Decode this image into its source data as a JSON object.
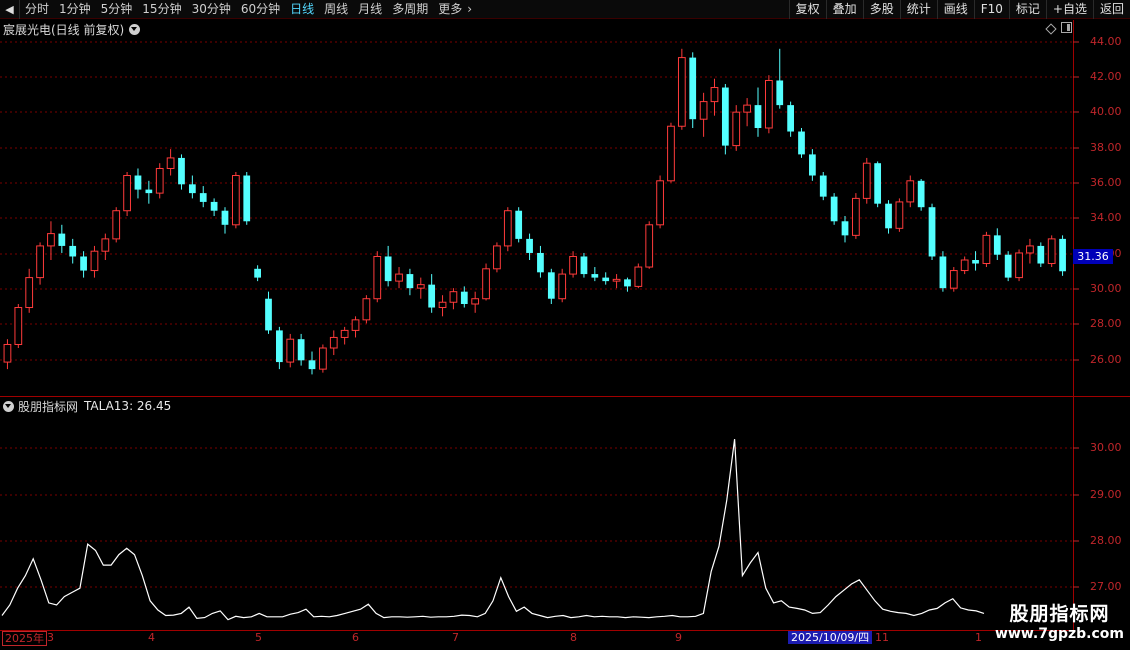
{
  "toolbar": {
    "back_icon": "back-arrow-icon",
    "periods": [
      "分时",
      "1分钟",
      "5分钟",
      "15分钟",
      "30分钟",
      "60分钟",
      "日线",
      "周线",
      "月线",
      "多周期",
      "更多"
    ],
    "active_period": "日线",
    "more_chevron": "›",
    "actions": [
      "复权",
      "叠加",
      "多股",
      "统计",
      "画线",
      "F10",
      "标记",
      "+自选",
      "返回"
    ]
  },
  "price_panel": {
    "title": "宸展光电(日线 前复权)",
    "axis_ticks": [
      "44.00",
      "42.00",
      "40.00",
      "38.00",
      "36.00",
      "34.00",
      "32.00",
      "30.00",
      "28.00",
      "26.00"
    ],
    "current_price": "31.36"
  },
  "indicator_panel": {
    "name": "股朋指标网",
    "indicator_label": "TALA13: 26.45",
    "axis_ticks": [
      "30.00",
      "29.00",
      "28.00",
      "27.00"
    ]
  },
  "date_axis": [
    "2025年",
    "3",
    "4",
    "5",
    "6",
    "7",
    "8",
    "9",
    "2025/10/09/四",
    "11",
    "1"
  ],
  "watermark": {
    "title": "股朋指标网",
    "url": "www.7gpzb.com"
  },
  "colors": {
    "up": "#ff3b3b",
    "down": "#54ffff",
    "grid": "#7a0000",
    "axis": "#c0262a",
    "indicator_line": "#ffffff",
    "highlight": "#1c1cb0"
  },
  "chart_data": [
    {
      "type": "candlestick",
      "title": "宸展光电(日线 前复权)",
      "ylim": [
        24.5,
        44.5
      ],
      "ohlc": [
        [
          26.2,
          27.5,
          25.8,
          27.2
        ],
        [
          27.2,
          29.5,
          27.0,
          29.3
        ],
        [
          29.3,
          31.5,
          29.0,
          31.0
        ],
        [
          31.0,
          33.0,
          30.6,
          32.8
        ],
        [
          32.8,
          34.2,
          32.0,
          33.5
        ],
        [
          33.5,
          34.0,
          32.4,
          32.8
        ],
        [
          32.8,
          33.2,
          31.8,
          32.2
        ],
        [
          32.2,
          32.5,
          31.0,
          31.4
        ],
        [
          31.4,
          32.8,
          31.0,
          32.5
        ],
        [
          32.5,
          33.5,
          32.0,
          33.2
        ],
        [
          33.2,
          35.0,
          33.0,
          34.8
        ],
        [
          34.8,
          37.0,
          34.5,
          36.8
        ],
        [
          36.8,
          37.2,
          35.5,
          36.0
        ],
        [
          36.0,
          36.5,
          35.2,
          35.8
        ],
        [
          35.8,
          37.5,
          35.5,
          37.2
        ],
        [
          37.2,
          38.3,
          36.8,
          37.8
        ],
        [
          37.8,
          38.0,
          36.0,
          36.3
        ],
        [
          36.3,
          36.8,
          35.5,
          35.8
        ],
        [
          35.8,
          36.2,
          35.0,
          35.3
        ],
        [
          35.3,
          35.5,
          34.5,
          34.8
        ],
        [
          34.8,
          35.0,
          33.5,
          34.0
        ],
        [
          34.0,
          37.0,
          33.8,
          36.8
        ],
        [
          36.8,
          37.0,
          34.0,
          34.2
        ],
        [
          31.5,
          31.7,
          30.8,
          31.0
        ],
        [
          29.8,
          30.2,
          27.8,
          28.0
        ],
        [
          28.0,
          28.2,
          25.8,
          26.2
        ],
        [
          26.2,
          27.8,
          25.9,
          27.5
        ],
        [
          27.5,
          27.8,
          26.0,
          26.3
        ],
        [
          26.3,
          26.8,
          25.5,
          25.8
        ],
        [
          25.8,
          27.2,
          25.6,
          27.0
        ],
        [
          27.0,
          28.0,
          26.6,
          27.6
        ],
        [
          27.6,
          28.2,
          27.2,
          28.0
        ],
        [
          28.0,
          28.8,
          27.6,
          28.6
        ],
        [
          28.6,
          30.0,
          28.4,
          29.8
        ],
        [
          29.8,
          32.5,
          29.6,
          32.2
        ],
        [
          32.2,
          32.8,
          30.5,
          30.8
        ],
        [
          30.8,
          31.6,
          30.4,
          31.2
        ],
        [
          31.2,
          31.5,
          30.0,
          30.4
        ],
        [
          30.4,
          31.0,
          29.8,
          30.6
        ],
        [
          30.6,
          31.2,
          29.0,
          29.3
        ],
        [
          29.3,
          30.0,
          28.8,
          29.6
        ],
        [
          29.6,
          30.4,
          29.2,
          30.2
        ],
        [
          30.2,
          30.5,
          29.3,
          29.5
        ],
        [
          29.5,
          30.2,
          29.0,
          29.8
        ],
        [
          29.8,
          31.8,
          29.7,
          31.5
        ],
        [
          31.5,
          33.0,
          31.3,
          32.8
        ],
        [
          32.8,
          35.0,
          32.5,
          34.8
        ],
        [
          34.8,
          35.0,
          33.0,
          33.2
        ],
        [
          33.2,
          33.5,
          32.0,
          32.4
        ],
        [
          32.4,
          32.8,
          31.0,
          31.3
        ],
        [
          31.3,
          31.5,
          29.5,
          29.8
        ],
        [
          29.8,
          31.5,
          29.6,
          31.2
        ],
        [
          31.2,
          32.5,
          31.0,
          32.2
        ],
        [
          32.2,
          32.4,
          31.0,
          31.2
        ],
        [
          31.2,
          31.6,
          30.8,
          31.0
        ],
        [
          31.0,
          31.3,
          30.6,
          30.8
        ],
        [
          30.8,
          31.2,
          30.4,
          30.9
        ],
        [
          30.9,
          31.0,
          30.2,
          30.5
        ],
        [
          30.5,
          31.8,
          30.4,
          31.6
        ],
        [
          31.6,
          34.2,
          31.5,
          34.0
        ],
        [
          34.0,
          36.8,
          33.8,
          36.5
        ],
        [
          36.5,
          39.8,
          36.4,
          39.6
        ],
        [
          39.6,
          44.0,
          39.4,
          43.5
        ],
        [
          43.5,
          43.8,
          39.5,
          40.0
        ],
        [
          40.0,
          41.5,
          39.0,
          41.0
        ],
        [
          41.0,
          42.3,
          40.2,
          41.8
        ],
        [
          41.8,
          42.0,
          38.0,
          38.5
        ],
        [
          38.5,
          40.8,
          38.2,
          40.4
        ],
        [
          40.4,
          41.2,
          39.6,
          40.8
        ],
        [
          40.8,
          41.8,
          39.0,
          39.5
        ],
        [
          39.5,
          42.5,
          39.2,
          42.2
        ],
        [
          42.2,
          44.0,
          40.6,
          40.8
        ],
        [
          40.8,
          41.0,
          39.0,
          39.3
        ],
        [
          39.3,
          39.5,
          37.8,
          38.0
        ],
        [
          38.0,
          38.3,
          36.5,
          36.8
        ],
        [
          36.8,
          37.0,
          35.4,
          35.6
        ],
        [
          35.6,
          35.8,
          34.0,
          34.2
        ],
        [
          34.2,
          34.5,
          33.0,
          33.4
        ],
        [
          33.4,
          35.8,
          33.2,
          35.5
        ],
        [
          35.5,
          37.8,
          35.2,
          37.5
        ],
        [
          37.5,
          37.6,
          35.0,
          35.2
        ],
        [
          35.2,
          35.4,
          33.5,
          33.8
        ],
        [
          33.8,
          35.5,
          33.6,
          35.3
        ],
        [
          35.3,
          36.8,
          35.0,
          36.5
        ],
        [
          36.5,
          36.6,
          34.8,
          35.0
        ],
        [
          35.0,
          35.2,
          32.0,
          32.2
        ],
        [
          32.2,
          32.5,
          30.2,
          30.4
        ],
        [
          30.4,
          31.6,
          30.2,
          31.4
        ],
        [
          31.4,
          32.2,
          31.2,
          32.0
        ],
        [
          32.0,
          32.5,
          31.4,
          31.8
        ],
        [
          31.8,
          33.6,
          31.6,
          33.4
        ],
        [
          33.4,
          33.8,
          32.0,
          32.3
        ],
        [
          32.3,
          32.5,
          30.8,
          31.0
        ],
        [
          31.0,
          32.6,
          30.8,
          32.4
        ],
        [
          32.4,
          33.2,
          31.8,
          32.8
        ],
        [
          32.8,
          33.0,
          31.6,
          31.8
        ],
        [
          31.8,
          33.4,
          31.6,
          33.2
        ],
        [
          33.2,
          33.4,
          31.1,
          31.36
        ]
      ]
    },
    {
      "type": "line",
      "name": "TALA13",
      "ylim": [
        26.4,
        31.4
      ],
      "values": [
        26.65,
        26.9,
        27.3,
        27.6,
        28.0,
        27.5,
        26.95,
        26.9,
        27.1,
        27.2,
        27.3,
        28.35,
        28.2,
        27.85,
        27.85,
        28.1,
        28.25,
        28.1,
        27.6,
        27.0,
        26.78,
        26.65,
        26.66,
        26.7,
        26.85,
        26.58,
        26.6,
        26.7,
        26.76,
        26.55,
        26.63,
        26.6,
        26.62,
        26.7,
        26.62,
        26.62,
        26.62,
        26.68,
        26.72,
        26.8,
        26.62,
        26.63,
        26.62,
        26.65,
        26.7,
        26.75,
        26.8,
        26.92,
        26.7,
        26.6,
        26.62,
        26.62,
        26.61,
        26.62,
        26.63,
        26.61,
        26.62,
        26.62,
        26.63,
        26.66,
        26.65,
        26.62,
        26.7,
        27.0,
        27.55,
        27.1,
        26.75,
        26.85,
        26.7,
        26.65,
        26.6,
        26.63,
        26.65,
        26.6,
        26.62,
        26.65,
        26.62,
        26.63,
        26.62,
        26.62,
        26.6,
        26.62,
        26.61,
        26.6,
        26.62,
        26.63,
        26.65,
        26.62,
        26.62,
        26.63,
        26.7,
        27.7,
        28.3,
        29.4,
        30.85,
        27.6,
        27.9,
        28.15,
        27.3,
        26.95,
        27.0,
        26.85,
        26.82,
        26.78,
        26.7,
        26.72,
        26.9,
        27.1,
        27.25,
        27.4,
        27.5,
        27.25,
        27.0,
        26.8,
        26.75,
        26.72,
        26.7,
        26.65,
        26.7,
        26.78,
        26.82,
        26.95,
        27.05,
        26.83,
        26.78,
        26.76,
        26.7
      ]
    }
  ]
}
